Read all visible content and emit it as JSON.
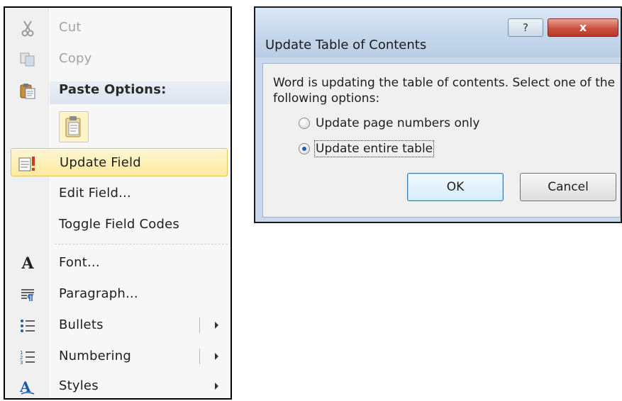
{
  "context_menu": {
    "items": [
      {
        "label": "Cut",
        "icon": "scissors-icon",
        "state": "disabled"
      },
      {
        "label": "Copy",
        "icon": "copy-icon",
        "state": "disabled"
      },
      {
        "label": "Paste Options:",
        "icon": "paste-icon",
        "state": "header"
      },
      {
        "label": "Update Field",
        "icon": "update-field-icon",
        "state": "highlighted"
      },
      {
        "label": "Edit Field...",
        "icon": "",
        "state": "normal"
      },
      {
        "label": "Toggle Field Codes",
        "icon": "",
        "state": "normal"
      },
      {
        "label": "Font...",
        "icon": "font-icon",
        "state": "normal"
      },
      {
        "label": "Paragraph...",
        "icon": "paragraph-icon",
        "state": "normal"
      },
      {
        "label": "Bullets",
        "icon": "bullets-icon",
        "state": "submenu"
      },
      {
        "label": "Numbering",
        "icon": "numbering-icon",
        "state": "submenu"
      },
      {
        "label": "Styles",
        "icon": "styles-icon",
        "state": "submenu"
      }
    ],
    "paste_option_icon": "keep-text-only-paste-icon"
  },
  "dialog": {
    "title": "Update Table of Contents",
    "help_label": "?",
    "close_label": "x",
    "message": "Word is updating the table of contents.  Select one of the following options:",
    "options": [
      {
        "label": "Update page numbers only",
        "checked": false
      },
      {
        "label": "Update entire table",
        "checked": true
      }
    ],
    "ok_label": "OK",
    "cancel_label": "Cancel"
  },
  "colors": {
    "highlight_fill": "#fde9a0",
    "highlight_border": "#e6c35a",
    "titlebar": "#c5d7ec",
    "close_button": "#c9513e",
    "ok_border": "#3c7fb1"
  }
}
